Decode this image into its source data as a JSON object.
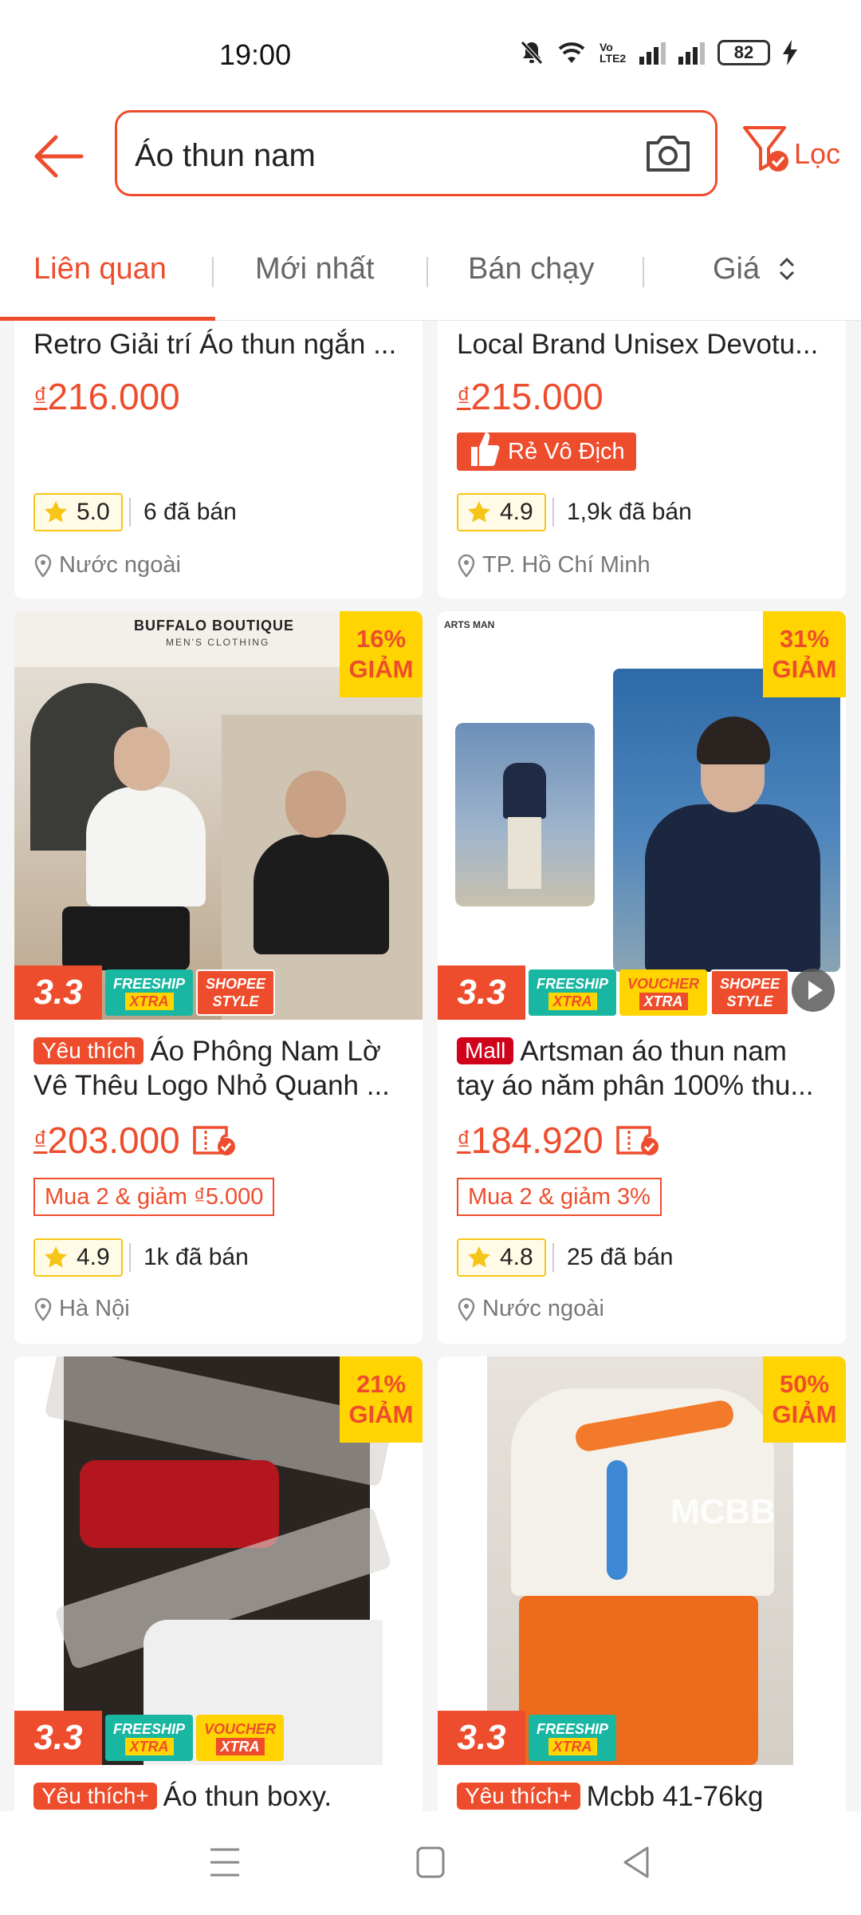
{
  "status": {
    "time": "19:00",
    "battery": "82",
    "volte": "Vo LTE2"
  },
  "search": {
    "query": "Áo thun nam",
    "filter_label": "Lọc"
  },
  "tabs": [
    {
      "label": "Liên quan"
    },
    {
      "label": "Mới nhất"
    },
    {
      "label": "Bán chạy"
    },
    {
      "label": "Giá"
    }
  ],
  "products": [
    {
      "title_lines": [
        "Retro Giải trí Áo thun ngắn ..."
      ],
      "price": "216.000",
      "currency": "₫",
      "rating": "5.0",
      "sold": "6 đã bán",
      "location": "Nước ngoài"
    },
    {
      "title_lines": [
        "Local Brand Unisex Devotu..."
      ],
      "price": "215.000",
      "currency": "₫",
      "label_badge": "Rẻ Vô Địch",
      "rating": "4.9",
      "sold": "1,9k đã bán",
      "location": "TP. Hồ Chí Minh"
    },
    {
      "shop_banner": "BUFFALO BOUTIQUE",
      "shop_sub": "MEN'S CLOTHING",
      "discount": [
        "16%",
        "GIẢM"
      ],
      "badge": "Yêu thích",
      "title_lines": [
        "Áo Phông Nam Lờ",
        "Vê Thêu Logo Nhỏ Quanh ..."
      ],
      "price": "203.000",
      "currency": "₫",
      "promo": "Mua 2 & giảm ₫5.000",
      "rating": "4.9",
      "sold": "1k đã bán",
      "location": "Hà Nội"
    },
    {
      "shop_banner": "ARTS MAN",
      "discount": [
        "31%",
        "GIẢM"
      ],
      "badge": "Mall",
      "title_lines": [
        "Artsman áo thun nam",
        "tay áo năm phân 100% thu..."
      ],
      "price": "184.920",
      "currency": "₫",
      "promo": "Mua 2 & giảm 3%",
      "rating": "4.8",
      "sold": "25 đã bán",
      "location": "Nước ngoài"
    },
    {
      "discount": [
        "21%",
        "GIẢM"
      ],
      "badge": "Yêu thích+",
      "title_lines": [
        "Áo thun boxy."
      ]
    },
    {
      "discount": [
        "50%",
        "GIẢM"
      ],
      "image_text": "MCBB",
      "badge": "Yêu thích+",
      "title_lines": [
        "Mcbb 41-76kg"
      ]
    }
  ],
  "promo_chips": {
    "b33": "3.3",
    "freeship": [
      "FREESHIP",
      "XTRA"
    ],
    "voucher": [
      "VOUCHER",
      "XTRA"
    ],
    "style": [
      "SHOPEE",
      "STYLE"
    ]
  },
  "colors": {
    "accent": "#ee4d2d",
    "discount_bg": "#ffd400",
    "star": "#f5c518"
  },
  "icons": [
    "back-arrow-icon",
    "camera-icon",
    "filter-icon",
    "star-icon",
    "location-pin-icon",
    "voucher-check-icon",
    "play-icon",
    "sort-updown-icon",
    "menu-icon",
    "home-square-icon",
    "back-triangle-icon"
  ]
}
